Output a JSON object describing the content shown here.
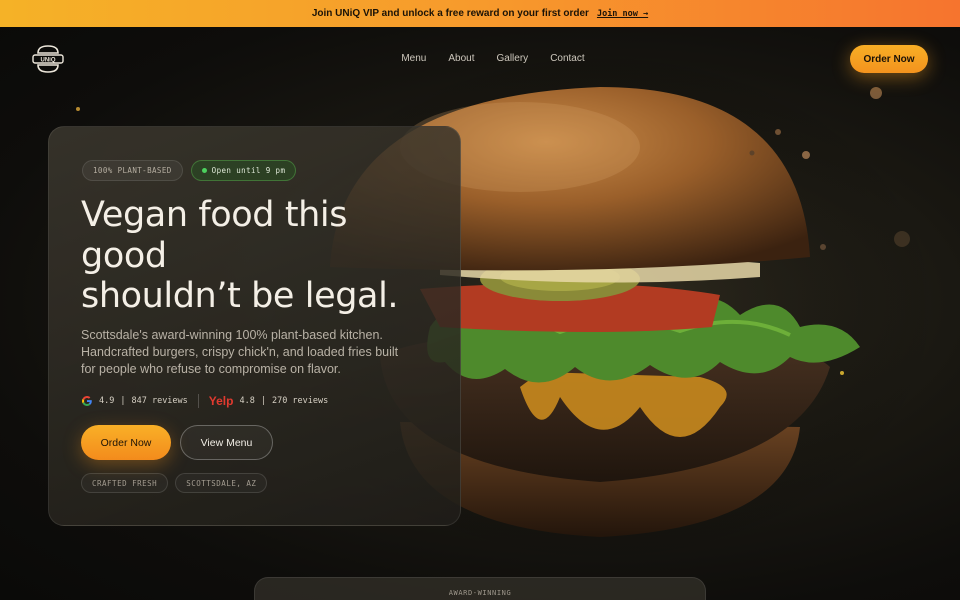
{
  "promo": {
    "text": "Join UNiQ VIP and unlock a free reward on your first order",
    "link": "Join now →"
  },
  "brand": {
    "logo_text": "UNiQ"
  },
  "nav": {
    "links": [
      "Menu",
      "About",
      "Gallery",
      "Contact"
    ],
    "order_label": "Order Now"
  },
  "hero": {
    "badges": {
      "plant_based": "100% PLANT-BASED",
      "open": "Open until 9 pm"
    },
    "headline_lines": [
      "Vegan food this",
      "good",
      "shouldn’t be legal."
    ],
    "subtitle": "Scottsdale's award-winning 100% plant-based kitchen. Handcrafted burgers, crispy chick'n, and loaded fries built for people who refuse to compromise on flavor.",
    "ratings": {
      "google": {
        "score": "4.9",
        "divider": "|",
        "reviews": "847 reviews"
      },
      "yelp": {
        "name": "Yelp",
        "score": "4.8",
        "divider": "|",
        "reviews": "270 reviews"
      }
    },
    "primary_cta": "Order Now",
    "secondary_cta": "View Menu",
    "tags": [
      "CRAFTED FRESH",
      "SCOTTSDALE, AZ"
    ]
  },
  "award": {
    "label": "AWARD-WINNING"
  },
  "colors": {
    "accent": "#f5a623",
    "promo_start": "#f5b227",
    "promo_end": "#f6742e",
    "open_green": "#4cd15e",
    "yelp_red": "#e03a2f"
  }
}
